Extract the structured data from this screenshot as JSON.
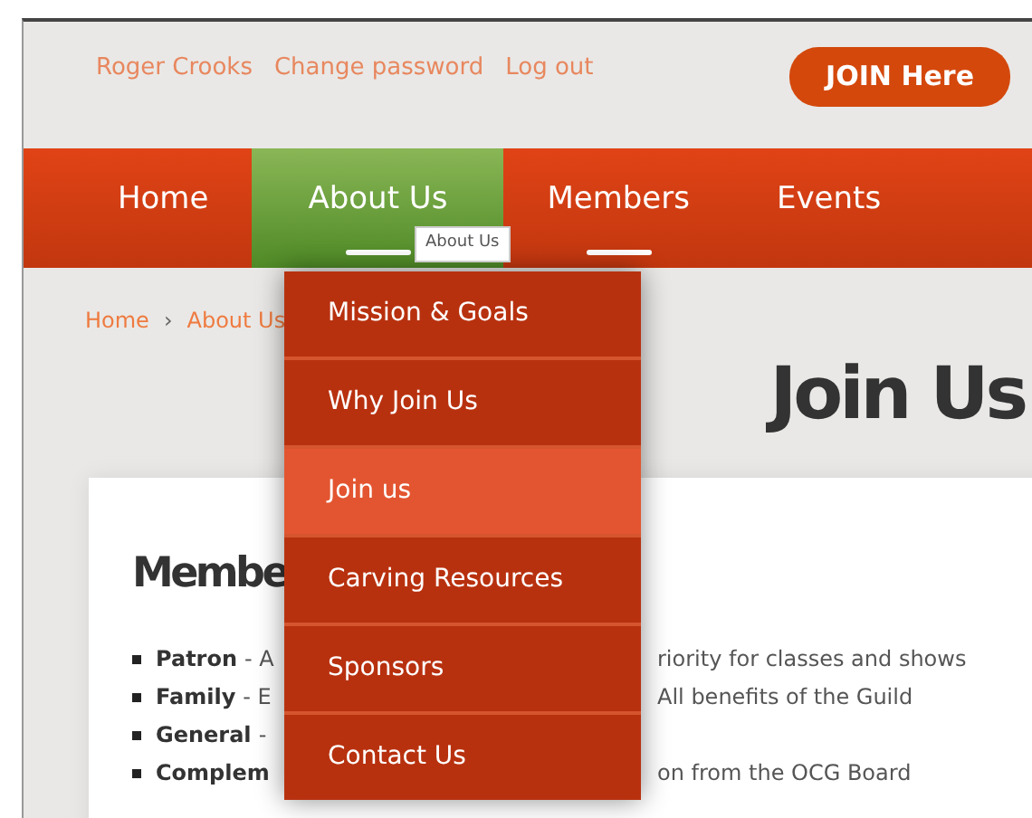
{
  "user_links": [
    "Roger Crooks",
    "Change password",
    "Log out"
  ],
  "join_button": "JOIN Here",
  "nav": [
    {
      "label": "Home",
      "selected": false,
      "underlined": false
    },
    {
      "label": "About Us",
      "selected": true,
      "underlined": true
    },
    {
      "label": "Members",
      "selected": false,
      "underlined": true
    },
    {
      "label": "Events",
      "selected": false,
      "underlined": false
    }
  ],
  "tooltip": "About Us",
  "dropdown": [
    {
      "label": "Mission & Goals",
      "selected": false
    },
    {
      "label": "Why Join Us",
      "selected": false
    },
    {
      "label": "Join us",
      "selected": true
    },
    {
      "label": "Carving Resources",
      "selected": false
    },
    {
      "label": "Sponsors",
      "selected": false
    },
    {
      "label": "Contact Us",
      "selected": false
    }
  ],
  "breadcrumb": [
    "Home",
    "›",
    "About Us"
  ],
  "page_title": "Join Us",
  "section_heading": "Membe",
  "memberships": [
    {
      "term": "Patron",
      "left": "- A",
      "right": "riority for classes and shows"
    },
    {
      "term": "Family",
      "left": "- E",
      "right": "All benefits of the Guild"
    },
    {
      "term": "General",
      "left": "-"
    },
    {
      "term": "Complem",
      "right": "on from the OCG Board"
    }
  ]
}
